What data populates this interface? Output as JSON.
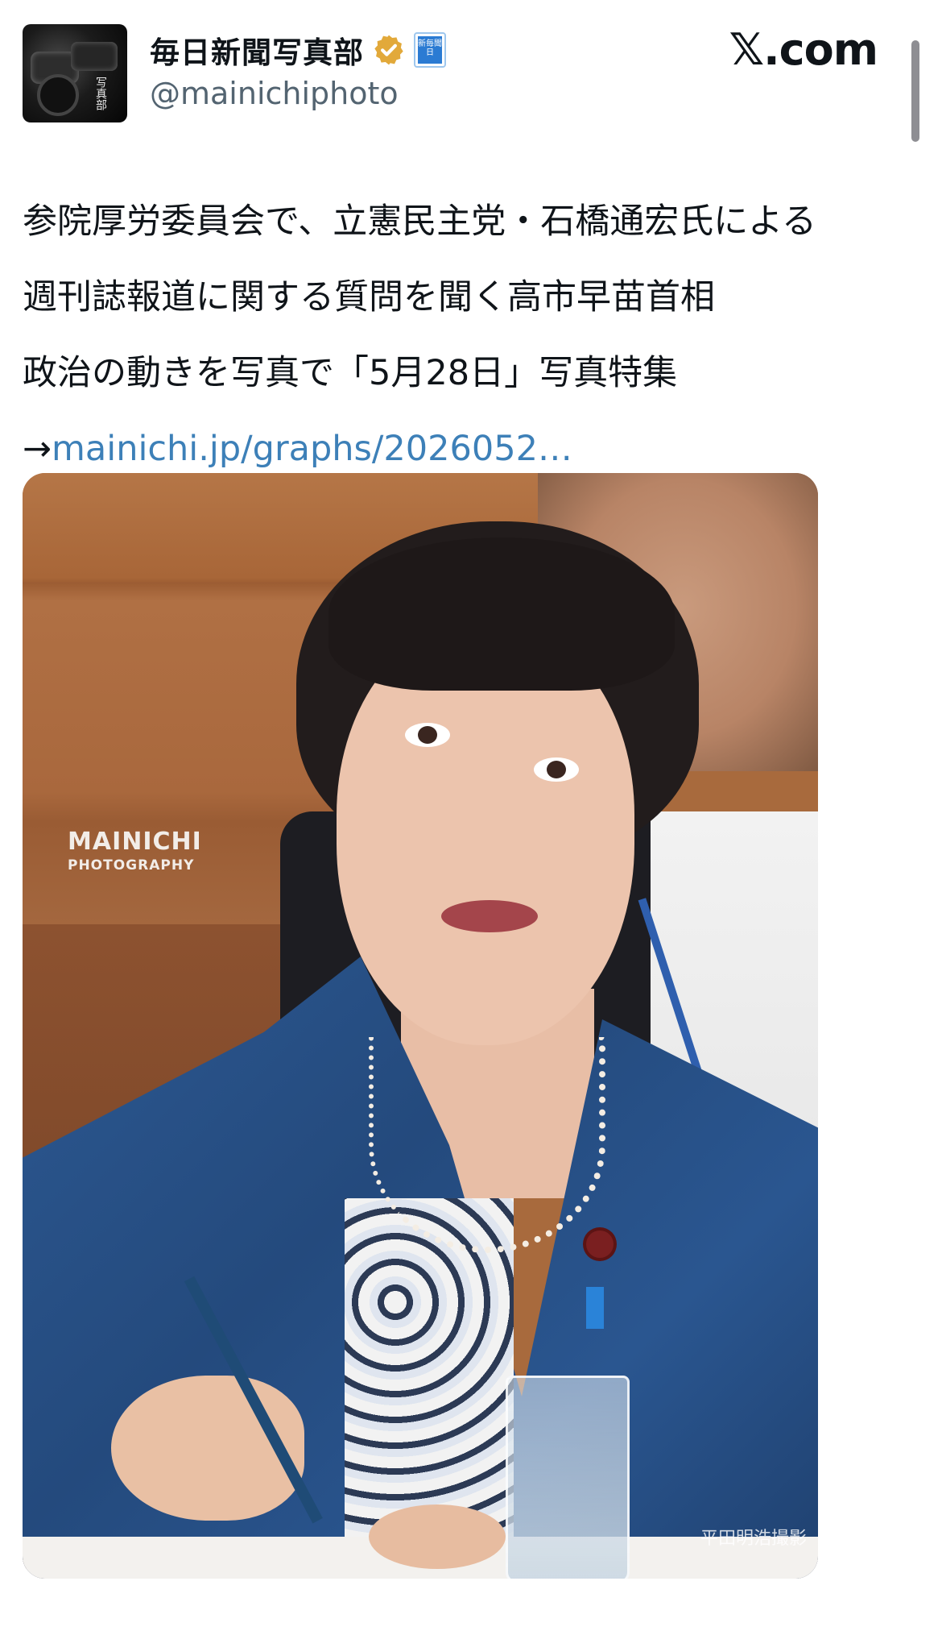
{
  "header": {
    "display_name": "毎日新聞写真部",
    "handle": "@mainichiphoto",
    "affiliate_badge": "新毎聞日",
    "site": "𝕏.com",
    "avatar_text": "写真部"
  },
  "tweet": {
    "lines": [
      "参院厚労委員会で、立憲民主党・石橋通宏氏による",
      "週刊誌報道に関する質問を聞く高市早苗首相",
      "政治の動きを写真で「5月28日」写真特集"
    ],
    "link_prefix": "→",
    "link_text": "mainichi.jp/graphs/2026052…"
  },
  "photo": {
    "watermark_title": "MAINICHI",
    "watermark_sub": "PHOTOGRAPHY",
    "credit": "平田明浩撮影"
  },
  "colors": {
    "link": "#3d80b8",
    "verified": "#e2a93a",
    "affiliate": "#2b7bd3"
  }
}
